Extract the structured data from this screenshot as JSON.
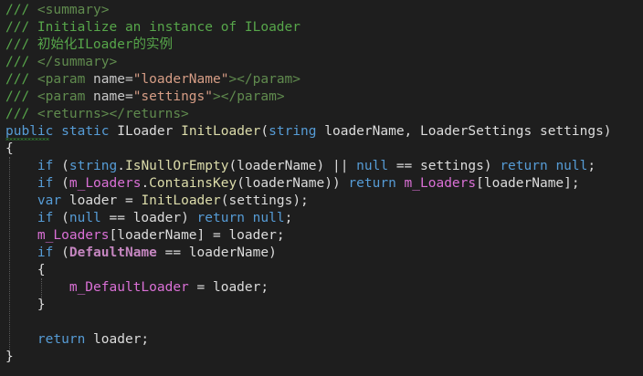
{
  "colors": {
    "background": "#1e1e1e",
    "comment": "#57a64a",
    "keyword": "#569cd6",
    "method": "#dcdcaa",
    "field": "#da70d6",
    "constant": "#c586c0",
    "plain": "#dcdcdc",
    "attr_value": "#d69d85"
  },
  "code_lines": [
    [
      {
        "t": "/// ",
        "c": "comment"
      },
      {
        "t": "<summary>",
        "c": "doctag"
      }
    ],
    [
      {
        "t": "/// Initialize an instance of ILoader",
        "c": "comment"
      }
    ],
    [
      {
        "t": "/// 初始化ILoader的实例",
        "c": "comment"
      }
    ],
    [
      {
        "t": "/// ",
        "c": "comment"
      },
      {
        "t": "</summary>",
        "c": "doctag"
      }
    ],
    [
      {
        "t": "/// ",
        "c": "comment"
      },
      {
        "t": "<param ",
        "c": "doctag"
      },
      {
        "t": "name=",
        "c": "docattr"
      },
      {
        "t": "\"loaderName\"",
        "c": "docval"
      },
      {
        "t": "></param>",
        "c": "doctag"
      }
    ],
    [
      {
        "t": "/// ",
        "c": "comment"
      },
      {
        "t": "<param ",
        "c": "doctag"
      },
      {
        "t": "name=",
        "c": "docattr"
      },
      {
        "t": "\"settings\"",
        "c": "docval"
      },
      {
        "t": "></param>",
        "c": "doctag"
      }
    ],
    [
      {
        "t": "/// ",
        "c": "comment"
      },
      {
        "t": "<returns></returns>",
        "c": "doctag"
      }
    ],
    [
      {
        "t": "public",
        "c": "keyword"
      },
      {
        "t": " ",
        "c": "plain"
      },
      {
        "t": "static",
        "c": "keyword"
      },
      {
        "t": " ILoader ",
        "c": "type"
      },
      {
        "t": "InitLoader",
        "c": "method"
      },
      {
        "t": "(",
        "c": "plain"
      },
      {
        "t": "string",
        "c": "keyword"
      },
      {
        "t": " loaderName, LoaderSettings settings)",
        "c": "plain"
      }
    ],
    [
      {
        "t": "{",
        "c": "plain"
      }
    ],
    [
      {
        "t": "    ",
        "c": "plain"
      },
      {
        "t": "if",
        "c": "keyword"
      },
      {
        "t": " (",
        "c": "plain"
      },
      {
        "t": "string",
        "c": "keyword"
      },
      {
        "t": ".",
        "c": "plain"
      },
      {
        "t": "IsNullOrEmpty",
        "c": "method"
      },
      {
        "t": "(loaderName) || ",
        "c": "plain"
      },
      {
        "t": "null",
        "c": "keyword"
      },
      {
        "t": " == settings) ",
        "c": "plain"
      },
      {
        "t": "return",
        "c": "keyword"
      },
      {
        "t": " ",
        "c": "plain"
      },
      {
        "t": "null",
        "c": "keyword"
      },
      {
        "t": ";",
        "c": "plain"
      }
    ],
    [
      {
        "t": "    ",
        "c": "plain"
      },
      {
        "t": "if",
        "c": "keyword"
      },
      {
        "t": " (",
        "c": "plain"
      },
      {
        "t": "m_Loaders",
        "c": "field"
      },
      {
        "t": ".",
        "c": "plain"
      },
      {
        "t": "ContainsKey",
        "c": "method"
      },
      {
        "t": "(loaderName)) ",
        "c": "plain"
      },
      {
        "t": "return",
        "c": "keyword"
      },
      {
        "t": " ",
        "c": "plain"
      },
      {
        "t": "m_Loaders",
        "c": "field"
      },
      {
        "t": "[loaderName];",
        "c": "plain"
      }
    ],
    [
      {
        "t": "    ",
        "c": "plain"
      },
      {
        "t": "var",
        "c": "keyword"
      },
      {
        "t": " loader = ",
        "c": "plain"
      },
      {
        "t": "InitLoader",
        "c": "method"
      },
      {
        "t": "(settings);",
        "c": "plain"
      }
    ],
    [
      {
        "t": "    ",
        "c": "plain"
      },
      {
        "t": "if",
        "c": "keyword"
      },
      {
        "t": " (",
        "c": "plain"
      },
      {
        "t": "null",
        "c": "keyword"
      },
      {
        "t": " == loader) ",
        "c": "plain"
      },
      {
        "t": "return",
        "c": "keyword"
      },
      {
        "t": " ",
        "c": "plain"
      },
      {
        "t": "null",
        "c": "keyword"
      },
      {
        "t": ";",
        "c": "plain"
      }
    ],
    [
      {
        "t": "    ",
        "c": "plain"
      },
      {
        "t": "m_Loaders",
        "c": "field"
      },
      {
        "t": "[loaderName] = loader;",
        "c": "plain"
      }
    ],
    [
      {
        "t": "    ",
        "c": "plain"
      },
      {
        "t": "if",
        "c": "keyword"
      },
      {
        "t": " (",
        "c": "plain"
      },
      {
        "t": "DefaultName",
        "c": "const"
      },
      {
        "t": " == loaderName)",
        "c": "plain"
      }
    ],
    [
      {
        "t": "    {",
        "c": "plain"
      }
    ],
    [
      {
        "t": "        ",
        "c": "plain"
      },
      {
        "t": "m_DefaultLoader",
        "c": "field"
      },
      {
        "t": " = loader;",
        "c": "plain"
      }
    ],
    [
      {
        "t": "    }",
        "c": "plain"
      }
    ],
    [],
    [
      {
        "t": "    ",
        "c": "plain"
      },
      {
        "t": "return",
        "c": "keyword"
      },
      {
        "t": " loader;",
        "c": "plain"
      }
    ],
    [
      {
        "t": "}",
        "c": "plain"
      }
    ]
  ]
}
